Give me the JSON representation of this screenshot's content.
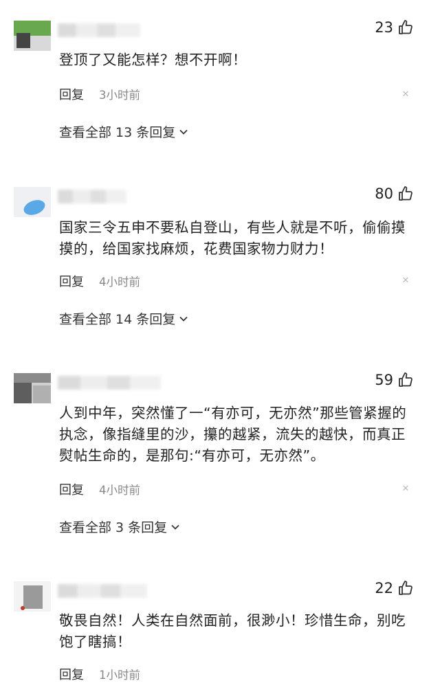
{
  "comments": [
    {
      "likes": "23",
      "text": "登顶了又能怎样？想不开啊！",
      "reply_label": "回复",
      "time": "3小时前",
      "view_all": "查看全部 13 条回复"
    },
    {
      "likes": "80",
      "text": "国家三令五申不要私自登山，有些人就是不听，偷偷摸摸的，给国家找麻烦，花费国家物力财力！",
      "reply_label": "回复",
      "time": "4小时前",
      "view_all": "查看全部 14 条回复"
    },
    {
      "likes": "59",
      "text": "人到中年，突然懂了一“有亦可，无亦然”那些管紧握的执念，像指缝里的沙，攥的越紧，流失的越快，而真正熨帖生命的，是那句:“有亦可，无亦然”。",
      "reply_label": "回复",
      "time": "4小时前",
      "view_all": "查看全部 3 条回复"
    },
    {
      "likes": "22",
      "text": "敬畏自然！人类在自然面前，很渺小！珍惜生命，别吃饱了瞎搞！",
      "reply_label": "回复",
      "time": "1小时前"
    }
  ],
  "icons": {
    "like": "thumbs-up-icon",
    "close": "close-icon",
    "expand": "chevron-down-icon"
  },
  "colors": {
    "text": "#222222",
    "meta": "#888888",
    "close": "#bbbbbb"
  }
}
